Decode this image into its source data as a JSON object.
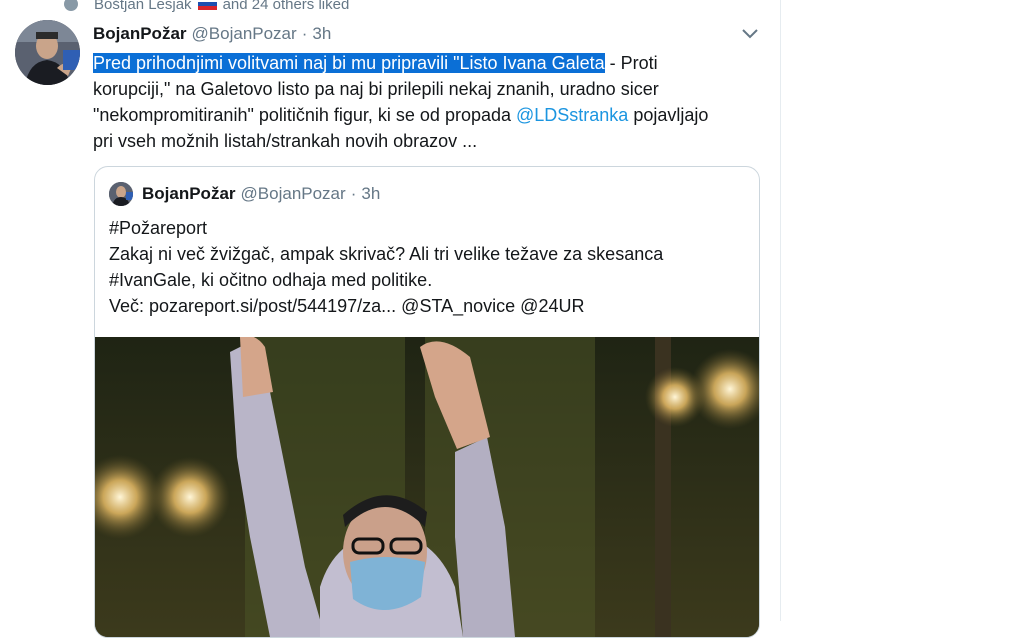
{
  "social_context": {
    "name": "Boštjan Lesjak",
    "flag": "slovenia-flag-icon",
    "rest": "and 24 others liked"
  },
  "tweet": {
    "name": "BojanPožar",
    "handle": "@BojanPozar",
    "sep": "·",
    "time": "3h",
    "text_highlighted": "Pred prihodnjimi volitvami naj bi mu pripravili \"Listo Ivana Galeta",
    "text_1": " - Proti korupciji,\" na Galetovo listo pa naj bi prilepili nekaj znanih, uradno sicer \"nekompromitiranih\" političnih figur, ki se od propada ",
    "mention": "@LDSstranka",
    "text_2": " pojavljajo pri vseh možnih listah/strankah novih obrazov ..."
  },
  "quoted": {
    "name": "BojanPožar",
    "handle": "@BojanPozar",
    "sep": "·",
    "time": "3h",
    "lines": [
      "#Požareport",
      "Zakaj ni več žvižgač, ampak skrivač? Ali tri velike težave za skesanca",
      "#IvanGale, ki očitno odhaja med politike.",
      "Več: pozareport.si/post/544197/za... @STA_novice @24UR"
    ]
  },
  "colors": {
    "highlight": "#0b6fd6",
    "link": "#1b95e0",
    "secondary_text": "#657786",
    "border": "#ccd6dd"
  }
}
